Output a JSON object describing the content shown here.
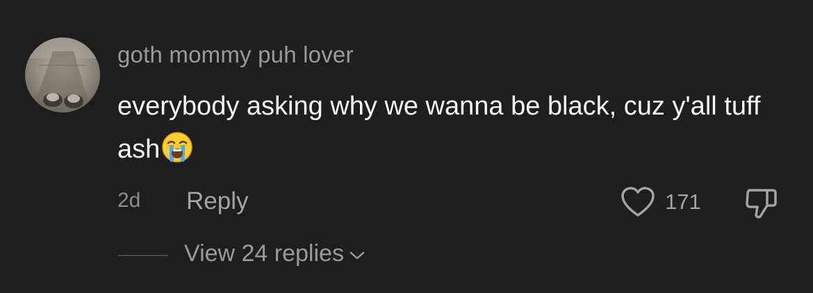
{
  "comment": {
    "username": "goth mommy puh lover",
    "text": "everybody asking why we wanna be black, cuz y'all tuff ash",
    "emoji_icon": "loudly-crying-face-icon",
    "time": "2d",
    "reply_label": "Reply",
    "like_count": "171",
    "view_replies_label": "View 24 replies"
  },
  "colors": {
    "background": "#1e1e1e",
    "username": "#9a9a9a",
    "text": "#f5f5f5",
    "muted": "#a3a3a3"
  }
}
